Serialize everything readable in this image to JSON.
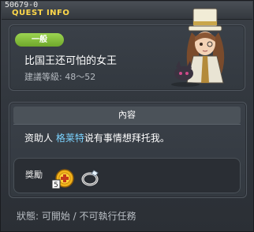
{
  "window": {
    "quest_id": "50679-0",
    "title": "QUEST INFO"
  },
  "quest": {
    "category_badge": "一般",
    "name": "比国王还可怕的女王",
    "level_requirement": "建議等級: 48～52"
  },
  "content": {
    "header": "內容",
    "desc_prefix": "资助人 ",
    "desc_npc": "格莱特",
    "desc_suffix": "说有事情想拜托我。"
  },
  "rewards": {
    "label": "獎勵",
    "items": [
      {
        "icon": "coin-exp-icon"
      },
      {
        "icon": "ring-icon"
      }
    ]
  },
  "status": {
    "text": "狀態: 可開始 / 不可執行任務"
  },
  "colors": {
    "title": "#ffd84a",
    "badge": "#8bc540",
    "npc_name": "#7bd3ff"
  }
}
